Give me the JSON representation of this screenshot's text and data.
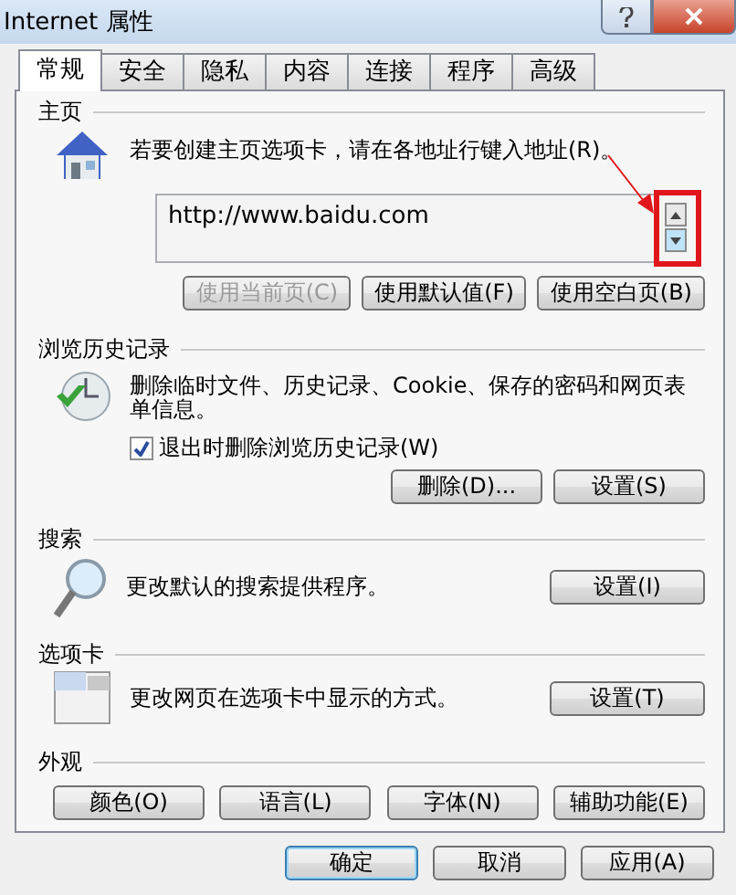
{
  "window": {
    "title": "Internet 属性"
  },
  "tabs": [
    {
      "label": "常规",
      "selected": true
    },
    {
      "label": "安全",
      "selected": false
    },
    {
      "label": "隐私",
      "selected": false
    },
    {
      "label": "内容",
      "selected": false
    },
    {
      "label": "连接",
      "selected": false
    },
    {
      "label": "程序",
      "selected": false
    },
    {
      "label": "高级",
      "selected": false
    }
  ],
  "sections": [
    {
      "kind": "home",
      "title": "主页",
      "description": "若要创建主页选项卡，请在各地址行键入地址(R)。",
      "url": "http://www.baidu.com",
      "buttons": [
        {
          "label": "使用当前页(C)",
          "disabled": true
        },
        {
          "label": "使用默认值(F)",
          "disabled": false
        },
        {
          "label": "使用空白页(B)",
          "disabled": false
        }
      ]
    },
    {
      "kind": "history",
      "title": "浏览历史记录",
      "description": "删除临时文件、历史记录、Cookie、保存的密码和网页表单信息。",
      "checkbox": {
        "label": "退出时删除浏览历史记录(W)",
        "checked": true
      },
      "buttons": [
        {
          "label": "删除(D)...",
          "disabled": false
        },
        {
          "label": "设置(S)",
          "disabled": false
        }
      ]
    },
    {
      "kind": "search",
      "title": "搜索",
      "description": "更改默认的搜索提供程序。",
      "buttons": [
        {
          "label": "设置(I)",
          "disabled": false
        }
      ]
    },
    {
      "kind": "tabs",
      "title": "选项卡",
      "description": "更改网页在选项卡中显示的方式。",
      "buttons": [
        {
          "label": "设置(T)",
          "disabled": false
        }
      ]
    },
    {
      "kind": "appearance",
      "title": "外观",
      "buttons": [
        {
          "label": "颜色(O)",
          "disabled": false
        },
        {
          "label": "语言(L)",
          "disabled": false
        },
        {
          "label": "字体(N)",
          "disabled": false
        },
        {
          "label": "辅助功能(E)",
          "disabled": false
        }
      ]
    }
  ],
  "footer": [
    {
      "label": "确定",
      "default": true
    },
    {
      "label": "取消",
      "default": false
    },
    {
      "label": "应用(A)",
      "default": false
    }
  ]
}
